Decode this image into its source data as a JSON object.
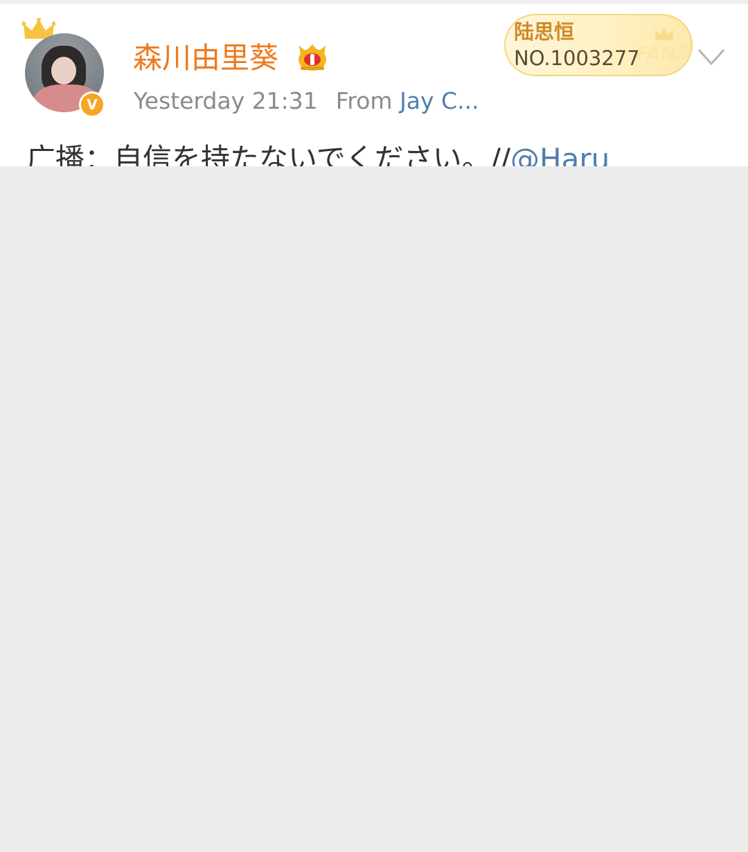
{
  "post": {
    "author": {
      "name": "森川由里葵",
      "verified_badge": "V",
      "avatar_icon": "avatar-photo",
      "vip_icon": "crown-icon"
    },
    "meta": {
      "time": "Yesterday 21:31",
      "from_label": "From",
      "source": "Jay C..."
    },
    "fans_badge": {
      "name": "陆思恒",
      "number": "NO.1003277",
      "label": "FANS"
    },
    "content": {
      "text": "广播：自信を持たないでください。//",
      "mention": "@Haru"
    },
    "more_icon": "chevron-down-icon"
  },
  "colors": {
    "username": "#ef7a1a",
    "link": "#507daf",
    "meta": "#8a8a8a",
    "verified": "#f5a623",
    "background": "#ececec"
  }
}
